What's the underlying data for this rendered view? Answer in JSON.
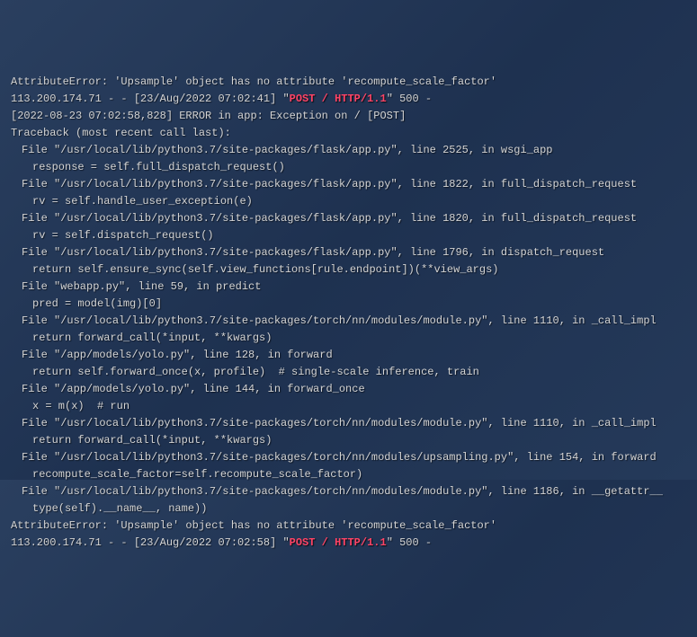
{
  "lines": [
    {
      "text": "AttributeError: 'Upsample' object has no attribute 'recompute_scale_factor'",
      "indent": 0
    },
    {
      "prefix": "113.200.174.71 - - [23/Aug/2022 07:02:41] \"",
      "highlight": "POST / HTTP/1.1",
      "suffix": "\" 500 -",
      "indent": 0,
      "request": true
    },
    {
      "text": "[2022-08-23 07:02:58,828] ERROR in app: Exception on / [POST]",
      "indent": 0
    },
    {
      "text": "Traceback (most recent call last):",
      "indent": 0
    },
    {
      "text": "File \"/usr/local/lib/python3.7/site-packages/flask/app.py\", line 2525, in wsgi_app",
      "indent": 1
    },
    {
      "text": "response = self.full_dispatch_request()",
      "indent": 2
    },
    {
      "text": "File \"/usr/local/lib/python3.7/site-packages/flask/app.py\", line 1822, in full_dispatch_request",
      "indent": 1
    },
    {
      "text": "rv = self.handle_user_exception(e)",
      "indent": 2
    },
    {
      "text": "File \"/usr/local/lib/python3.7/site-packages/flask/app.py\", line 1820, in full_dispatch_request",
      "indent": 1
    },
    {
      "text": "rv = self.dispatch_request()",
      "indent": 2
    },
    {
      "text": "File \"/usr/local/lib/python3.7/site-packages/flask/app.py\", line 1796, in dispatch_request",
      "indent": 1
    },
    {
      "text": "return self.ensure_sync(self.view_functions[rule.endpoint])(**view_args)",
      "indent": 2
    },
    {
      "text": "File \"webapp.py\", line 59, in predict",
      "indent": 1
    },
    {
      "text": "pred = model(img)[0]",
      "indent": 2
    },
    {
      "text": "File \"/usr/local/lib/python3.7/site-packages/torch/nn/modules/module.py\", line 1110, in _call_impl",
      "indent": 1
    },
    {
      "text": "return forward_call(*input, **kwargs)",
      "indent": 2
    },
    {
      "text": "File \"/app/models/yolo.py\", line 128, in forward",
      "indent": 1
    },
    {
      "text": "return self.forward_once(x, profile)  # single-scale inference, train",
      "indent": 2
    },
    {
      "text": "File \"/app/models/yolo.py\", line 144, in forward_once",
      "indent": 1
    },
    {
      "text": "x = m(x)  # run",
      "indent": 2
    },
    {
      "text": "File \"/usr/local/lib/python3.7/site-packages/torch/nn/modules/module.py\", line 1110, in _call_impl",
      "indent": 1
    },
    {
      "text": "return forward_call(*input, **kwargs)",
      "indent": 2
    },
    {
      "text": "File \"/usr/local/lib/python3.7/site-packages/torch/nn/modules/upsampling.py\", line 154, in forward",
      "indent": 1
    },
    {
      "text": "recompute_scale_factor=self.recompute_scale_factor)",
      "indent": 2
    },
    {
      "text": "File \"/usr/local/lib/python3.7/site-packages/torch/nn/modules/module.py\", line 1186, in __getattr__",
      "indent": 1
    },
    {
      "text": "type(self).__name__, name))",
      "indent": 2
    },
    {
      "text": "AttributeError: 'Upsample' object has no attribute 'recompute_scale_factor'",
      "indent": 0
    },
    {
      "prefix": "113.200.174.71 - - [23/Aug/2022 07:02:58] \"",
      "highlight": "POST / HTTP/1.1",
      "suffix": "\" 500 -",
      "indent": 0,
      "request": true
    }
  ]
}
